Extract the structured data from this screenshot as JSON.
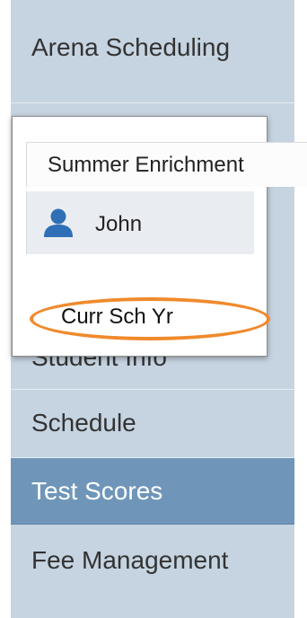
{
  "sidebar": {
    "items": [
      {
        "label": "Arena Scheduling"
      },
      {
        "label": "Student Info"
      },
      {
        "label": "Schedule"
      },
      {
        "label": "Test Scores",
        "active": true
      },
      {
        "label": "Fee Management"
      }
    ]
  },
  "popup": {
    "school_tab_label": "Summer Enrichment",
    "user": {
      "name": "John",
      "icon": "user-icon"
    },
    "year_option_label": "Curr Sch Yr"
  },
  "colors": {
    "sidebar_bg": "#c6d4e1",
    "active_bg": "#6f96b9",
    "highlight": "#f08a2c",
    "user_icon": "#2f6fb6"
  }
}
